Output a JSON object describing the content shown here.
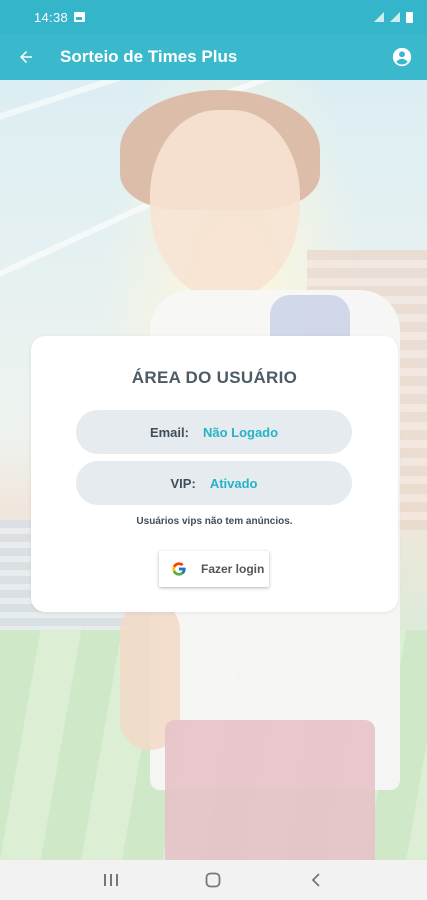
{
  "status_bar": {
    "time": "14:38"
  },
  "app_bar": {
    "title": "Sorteio de Times Plus"
  },
  "card": {
    "heading": "ÁREA DO USUÁRIO",
    "email_label": "Email:",
    "email_value": "Não Logado",
    "vip_label": "VIP:",
    "vip_value": "Ativado",
    "note": "Usuários vips não tem anúncios.",
    "login_button": "Fazer login"
  },
  "colors": {
    "primary": "#3ab8cc",
    "value_text": "#25b3c8",
    "pill_bg": "#e5ebef"
  },
  "icons": {
    "back": "arrow-left-icon",
    "account": "account-circle-icon",
    "google": "google-g-icon",
    "nav_recents": "recents-icon",
    "nav_home": "home-icon",
    "nav_back": "chevron-left-icon"
  }
}
